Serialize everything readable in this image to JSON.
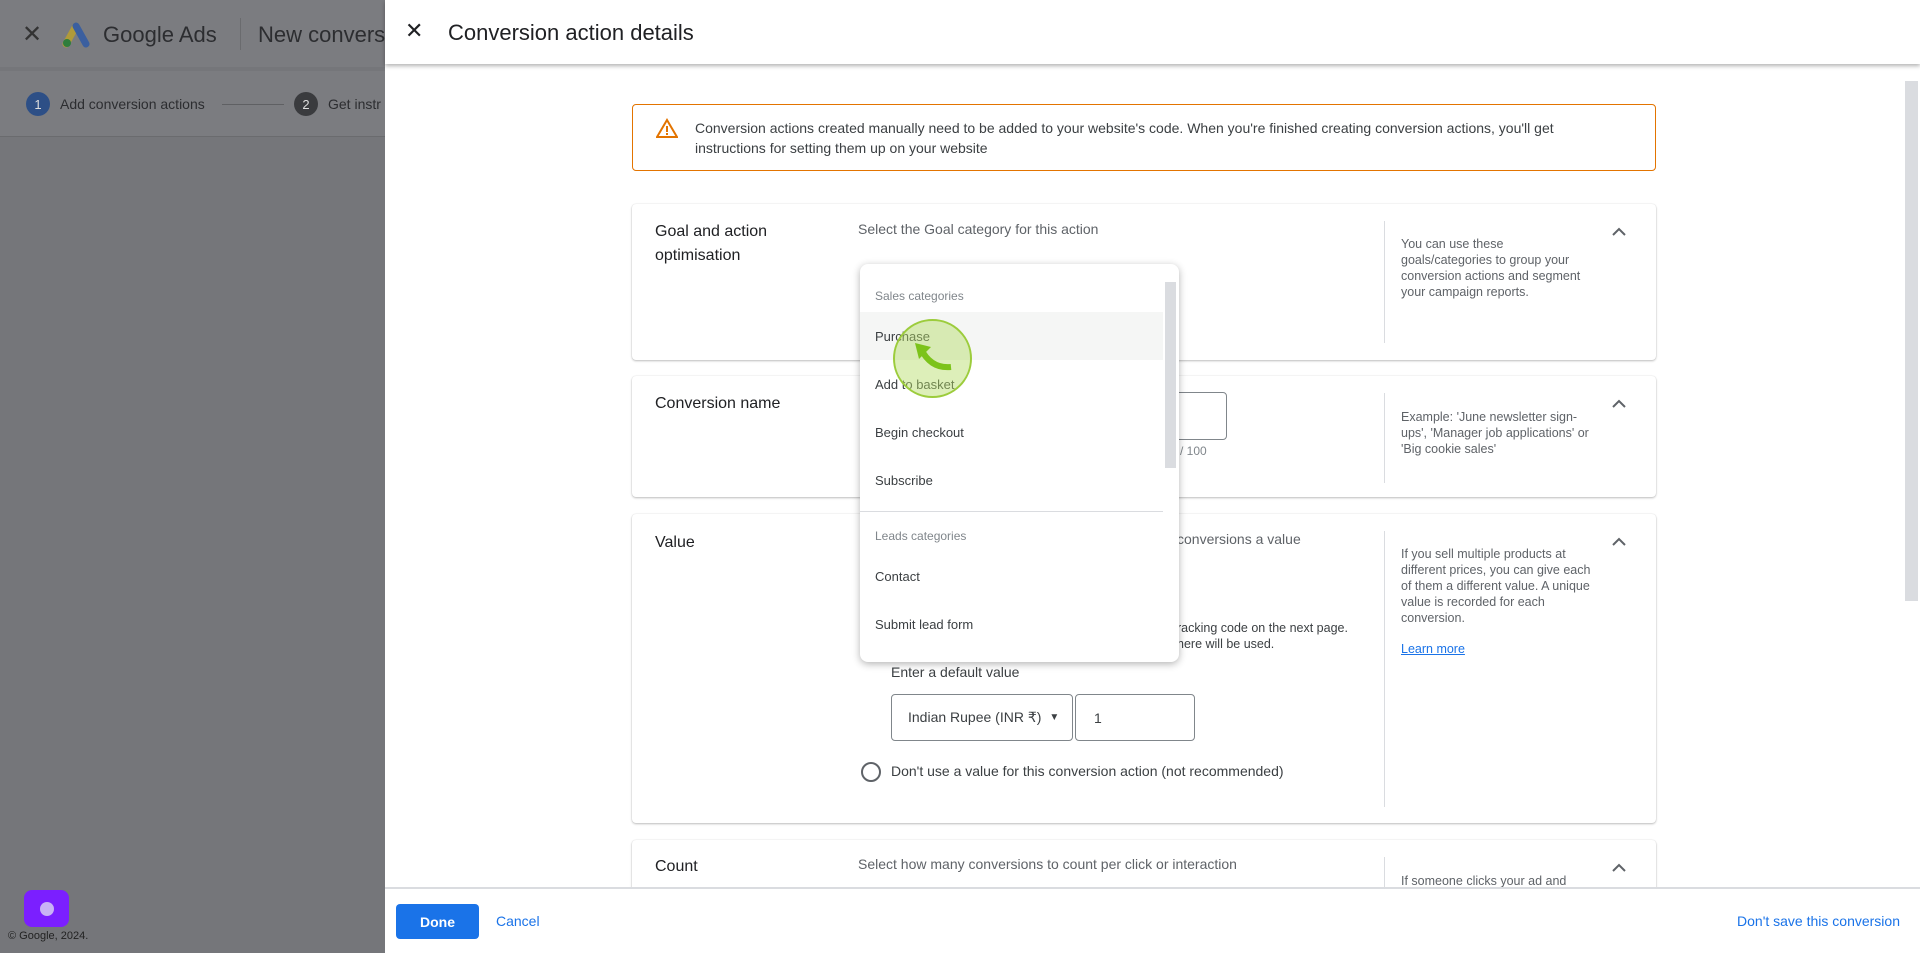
{
  "background_app": {
    "product": "Google Ads",
    "page_title": "New convers",
    "steps": [
      {
        "number": "1",
        "label": "Add conversion actions"
      },
      {
        "number": "2",
        "label": "Get instr"
      }
    ],
    "copyright": "© Google, 2024."
  },
  "panel": {
    "title": "Conversion action details"
  },
  "warning": {
    "text": "Conversion actions created manually need to be added to your website's code. When you're finished creating conversion actions, you'll get instructions for setting them up on your website"
  },
  "sections": {
    "goal": {
      "label": "Goal and action optimisation",
      "prompt": "Select the Goal category for this action",
      "help": "You can use these goals/categories to group your conversion actions and segment your campaign reports."
    },
    "name": {
      "label": "Conversion name",
      "counter": "/ 100",
      "help": "Example: 'June newsletter sign-ups', 'Manager job applications' or 'Big cookie sales'"
    },
    "value": {
      "label": "Value",
      "prompt_fragment": "conversions a value",
      "note_line1": "racking code on the next page.",
      "note_line2": "here will be used.",
      "default_value_label": "Enter a default value",
      "currency": "Indian Rupee (INR ₹)",
      "amount": "1",
      "no_value_option": "Don't use a value for this conversion action (not recommended)",
      "help": "If you sell multiple products at different prices, you can give each of them a different value. A unique value is recorded for each conversion.",
      "learn_more": "Learn more"
    },
    "count": {
      "label": "Count",
      "prompt": "Select how many conversions to count per click or interaction",
      "help": "If someone clicks your ad and"
    }
  },
  "dropdown": {
    "groups": [
      {
        "header": "Sales categories",
        "items": [
          "Purchase",
          "Add to basket",
          "Begin checkout",
          "Subscribe"
        ]
      },
      {
        "header": "Leads categories",
        "items": [
          "Contact",
          "Submit lead form"
        ]
      }
    ],
    "hovered": "Purchase"
  },
  "footer": {
    "done": "Done",
    "cancel": "Cancel",
    "dont_save": "Don't save this conversion"
  },
  "colors": {
    "accent": "#1a73e8",
    "warning": "#e37400",
    "click_indicator": "#8bc34a",
    "assistant_button": "#7b1fff"
  }
}
